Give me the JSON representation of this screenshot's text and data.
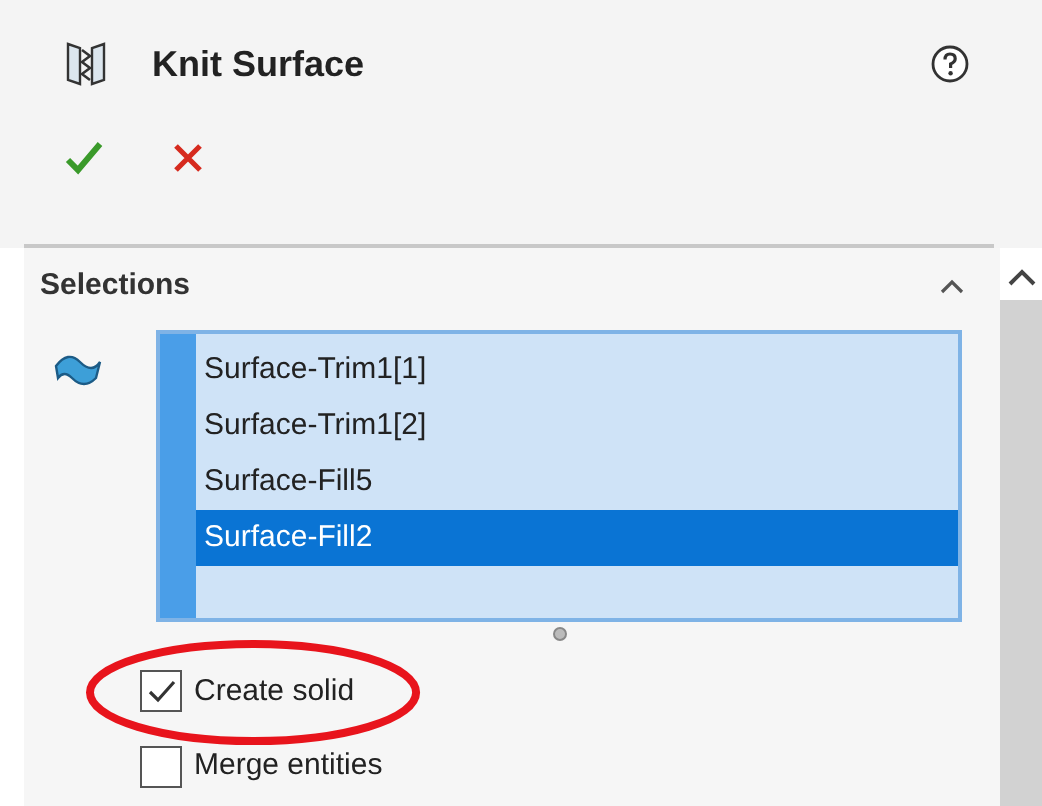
{
  "header": {
    "title": "Knit Surface"
  },
  "actions": [
    {
      "kind": "ok"
    },
    {
      "kind": "cancel"
    }
  ],
  "section": {
    "title": "Selections",
    "expanded": true,
    "items": [
      {
        "label": "Surface-Trim1[1]",
        "selected": false
      },
      {
        "label": "Surface-Trim1[2]",
        "selected": false
      },
      {
        "label": "Surface-Fill5",
        "selected": false
      },
      {
        "label": "Surface-Fill2",
        "selected": true
      }
    ]
  },
  "options": [
    {
      "label": "Create solid",
      "checked": true,
      "circled": true
    },
    {
      "label": "Merge entities",
      "checked": false,
      "circled": false
    }
  ]
}
